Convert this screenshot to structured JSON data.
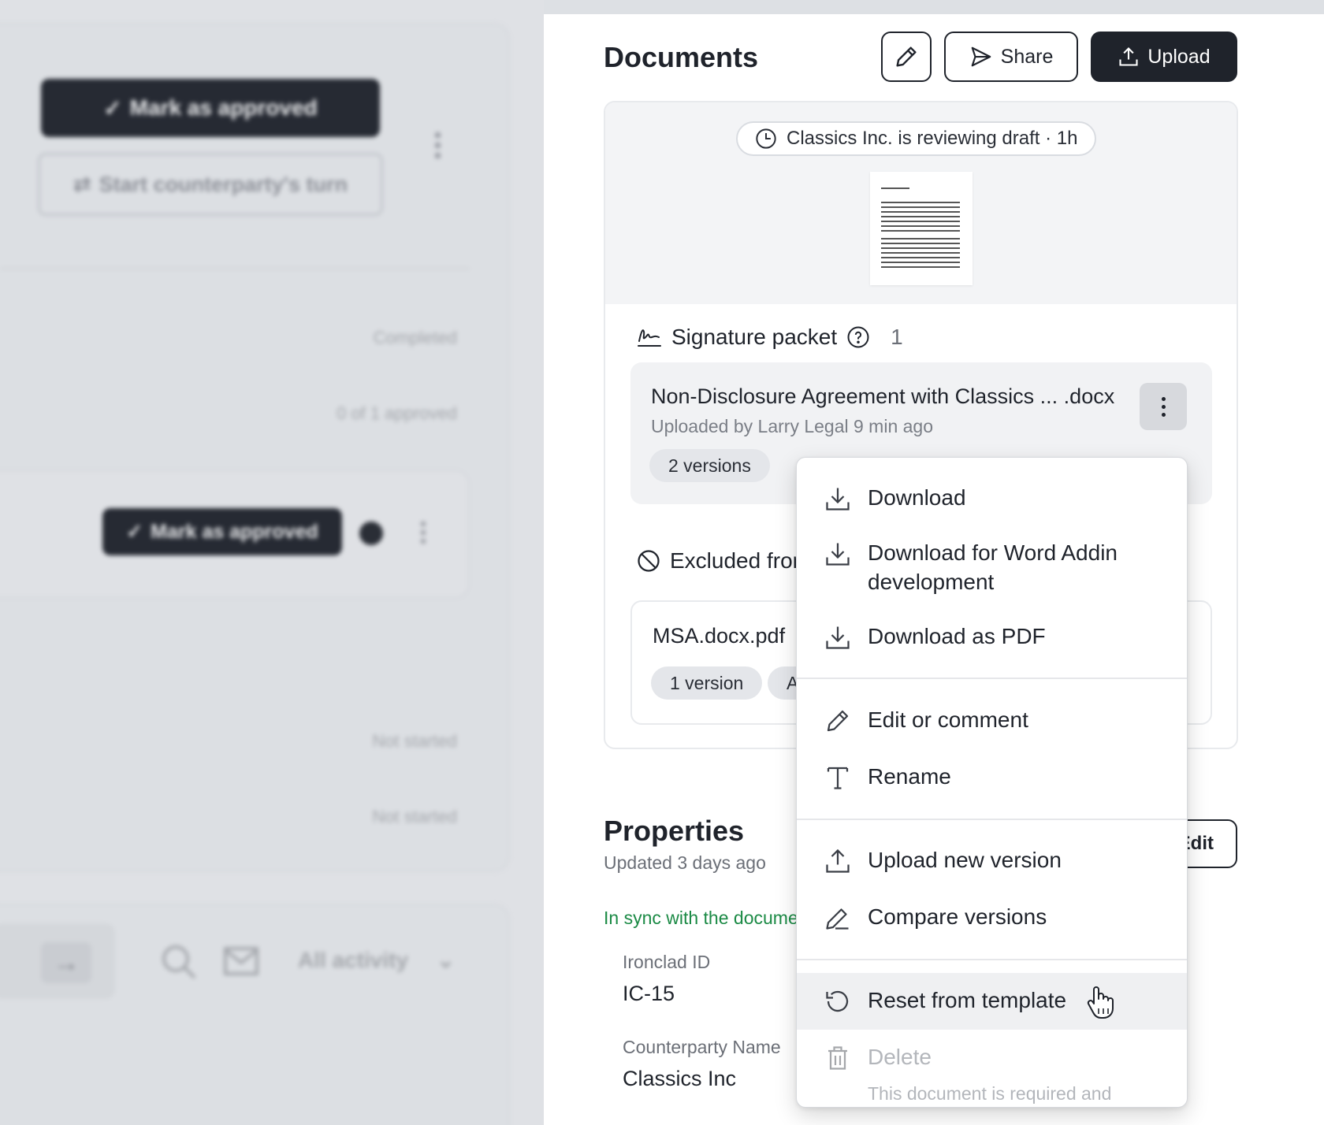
{
  "left_pane": {
    "mark_approved_label": "Mark as approved",
    "start_turn_label": "Start counterparty's turn",
    "status_completed": "Completed",
    "status_approved_count": "0 of 1 approved",
    "row_mark_approved_label": "Mark as approved",
    "status_not_started_1": "Not started",
    "status_not_started_2": "Not started",
    "activity_filter": "All activity"
  },
  "documents": {
    "title": "Documents",
    "share_label": "Share",
    "upload_label": "Upload",
    "review_status": "Classics Inc. is reviewing draft · 1h",
    "signature_packet": {
      "label": "Signature packet",
      "count": "1",
      "file": {
        "name": "Non-Disclosure Agreement with Classics ... .docx",
        "meta": "Uploaded by Larry Legal 9 min ago",
        "versions": "2 versions"
      }
    },
    "excluded": {
      "label": "Excluded from",
      "file": {
        "name": "MSA.docx.pdf",
        "versions": "1 version",
        "tag2": "A"
      }
    }
  },
  "properties": {
    "title": "Properties",
    "updated": "Updated 3 days ago",
    "edit_label": "Edit",
    "sync_text": "In sync with the document",
    "fields": [
      {
        "label": "Ironclad ID",
        "value": "IC-15"
      },
      {
        "label": "Counterparty Name",
        "value": "Classics Inc"
      }
    ]
  },
  "context_menu": {
    "items": [
      {
        "label": "Download",
        "icon": "download-icon"
      },
      {
        "label": "Download for Word Addin development",
        "icon": "download-icon"
      },
      {
        "label": "Download as PDF",
        "icon": "download-icon"
      },
      {
        "label": "Edit or comment",
        "icon": "pencil-icon"
      },
      {
        "label": "Rename",
        "icon": "text-icon"
      },
      {
        "label": "Upload new version",
        "icon": "upload-icon"
      },
      {
        "label": "Compare versions",
        "icon": "compare-icon"
      },
      {
        "label": "Reset from template",
        "icon": "reset-icon",
        "hovered": true
      },
      {
        "label": "Delete",
        "icon": "trash-icon",
        "disabled": true,
        "note": "This document is required and"
      }
    ]
  }
}
